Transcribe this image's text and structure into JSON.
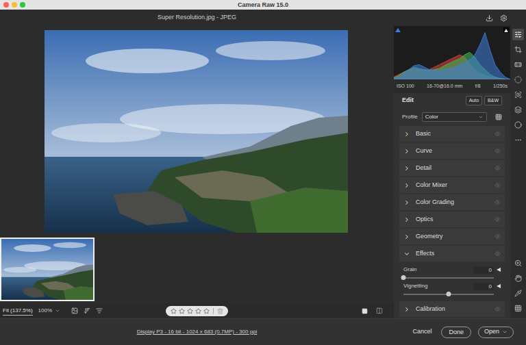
{
  "window": {
    "title": "Camera Raw 15.0"
  },
  "document": {
    "title": "Super Resolution.jpg - JPEG"
  },
  "histogram": {
    "series": [
      {
        "name": "red",
        "color": "#e0443c",
        "values": [
          0.05,
          0.1,
          0.15,
          0.2,
          0.22,
          0.2,
          0.18,
          0.2,
          0.25,
          0.3,
          0.35,
          0.4,
          0.45,
          0.5,
          0.45,
          0.3,
          0.2,
          0.12,
          0.08,
          0.05,
          0.03,
          0.02,
          0.01,
          0
        ]
      },
      {
        "name": "green",
        "color": "#3fbf5a",
        "values": [
          0.03,
          0.08,
          0.15,
          0.2,
          0.25,
          0.22,
          0.2,
          0.18,
          0.2,
          0.22,
          0.28,
          0.33,
          0.38,
          0.42,
          0.5,
          0.55,
          0.45,
          0.3,
          0.2,
          0.1,
          0.05,
          0.02,
          0.01,
          0
        ]
      },
      {
        "name": "blue",
        "color": "#3f7fe0",
        "values": [
          0.02,
          0.05,
          0.12,
          0.2,
          0.28,
          0.3,
          0.25,
          0.2,
          0.18,
          0.18,
          0.2,
          0.22,
          0.25,
          0.3,
          0.35,
          0.4,
          0.5,
          0.7,
          0.95,
          0.6,
          0.3,
          0.15,
          0.05,
          0
        ]
      }
    ]
  },
  "exif": [
    "ISO 100",
    "16-70@16.0 mm",
    "f/8",
    "1/250s"
  ],
  "edit": {
    "title": "Edit",
    "buttons": [
      "Auto",
      "B&W"
    ],
    "profile_label": "Profile",
    "profile_value": "Color"
  },
  "sections": [
    {
      "label": "Basic",
      "expanded": false
    },
    {
      "label": "Curve",
      "expanded": false
    },
    {
      "label": "Detail",
      "expanded": false
    },
    {
      "label": "Color Mixer",
      "expanded": false
    },
    {
      "label": "Color Grading",
      "expanded": false
    },
    {
      "label": "Optics",
      "expanded": false
    },
    {
      "label": "Geometry",
      "expanded": false
    },
    {
      "label": "Effects",
      "expanded": true,
      "sliders": [
        {
          "label": "Grain",
          "value": "0",
          "level": 0
        },
        {
          "label": "Vignetting",
          "value": "0",
          "level": 0.5
        }
      ]
    },
    {
      "label": "Calibration",
      "expanded": false
    }
  ],
  "tools": [
    {
      "selected": true
    },
    {
      "selected": false
    },
    {
      "selected": false
    },
    {
      "selected": false
    },
    {
      "selected": false
    },
    {
      "selected": false
    },
    {
      "selected": false
    },
    {
      "selected": false
    }
  ],
  "view_tools": [
    {
      "selected": false
    },
    {
      "selected": false
    },
    {
      "selected": false
    },
    {
      "selected": false
    }
  ],
  "zoom": [
    {
      "label": "Fit (137.5%)",
      "selected": true
    },
    {
      "label": "100%",
      "selected": false
    }
  ],
  "rating": {
    "max": 5,
    "stars": 0
  },
  "status": "Display P3 - 16 bit - 1024 x 683 (0.7MP) - 300 ppi",
  "buttons": [
    "Cancel",
    "Done",
    "Open"
  ]
}
